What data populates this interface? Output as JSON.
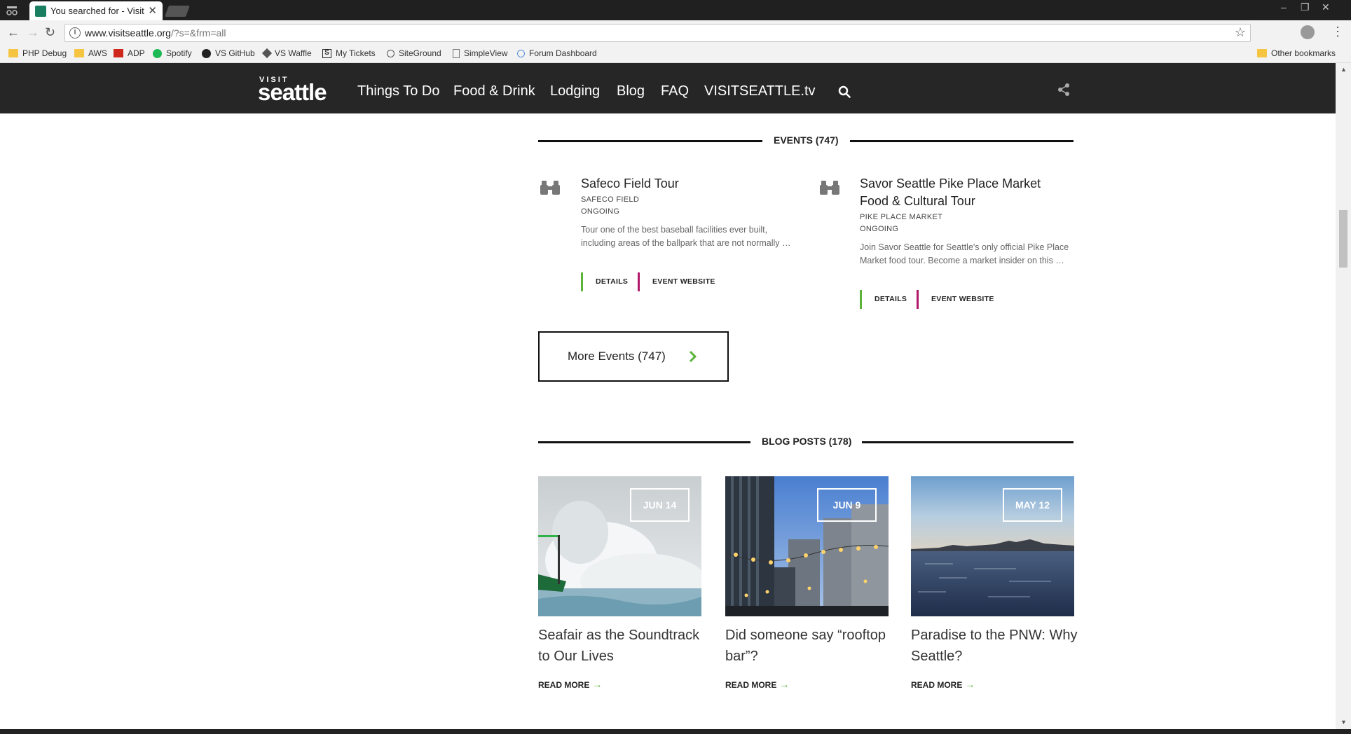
{
  "browser": {
    "tab_title": "You searched for - Visit Seattle",
    "url_main": "www.visitseattle.org",
    "url_rest": "/?s=&frm=all",
    "bookmarks": [
      {
        "label": "PHP Debug",
        "icon": "folder-icon"
      },
      {
        "label": "AWS",
        "icon": "folder-icon"
      },
      {
        "label": "ADP",
        "icon": "adp-icon"
      },
      {
        "label": "Spotify",
        "icon": "spotify-icon"
      },
      {
        "label": "VS GitHub",
        "icon": "github-icon"
      },
      {
        "label": "VS Waffle",
        "icon": "waffle-icon"
      },
      {
        "label": "My Tickets",
        "icon": "s-icon"
      },
      {
        "label": "SiteGround",
        "icon": "siteground-icon"
      },
      {
        "label": "SimpleView",
        "icon": "page-icon"
      },
      {
        "label": "Forum Dashboard",
        "icon": "globe-icon"
      }
    ],
    "other_bookmarks": "Other bookmarks"
  },
  "site": {
    "logo_small": "VISIT",
    "logo_big": "seattle",
    "nav": [
      "Things To Do",
      "Food & Drink",
      "Lodging",
      "Blog",
      "FAQ",
      "VISITSEATTLE.tv"
    ]
  },
  "events": {
    "heading": "EVENTS (747)",
    "items": [
      {
        "title": "Safeco Field Tour",
        "venue": "SAFECO FIELD",
        "when": "ONGOING",
        "desc": "Tour one of the best baseball facilities ever built, including areas of the ballpark that are not normally …",
        "details": "DETAILS",
        "website": "EVENT WEBSITE"
      },
      {
        "title": "Savor Seattle Pike Place Market Food & Cultural Tour",
        "venue": "PIKE PLACE MARKET",
        "when": "ONGOING",
        "desc": "Join Savor Seattle for Seattle's only official Pike Place Market food tour. Become a market insider on this …",
        "details": "DETAILS",
        "website": "EVENT WEBSITE"
      }
    ],
    "more_label": "More Events (747)"
  },
  "blog": {
    "heading": "BLOG POSTS (178)",
    "posts": [
      {
        "date": "JUN 14",
        "title": "Seafair as the Soundtrack to Our Lives",
        "read_more": "READ MORE"
      },
      {
        "date": "JUN 9",
        "title": "Did someone say “rooftop bar”?",
        "read_more": "READ MORE"
      },
      {
        "date": "MAY 12",
        "title": "Paradise to the PNW: Why Seattle?",
        "read_more": "READ MORE"
      }
    ]
  },
  "colors": {
    "nav_bg": "#262626",
    "accent_green": "#5bb33a",
    "accent_magenta": "#b0186a"
  }
}
